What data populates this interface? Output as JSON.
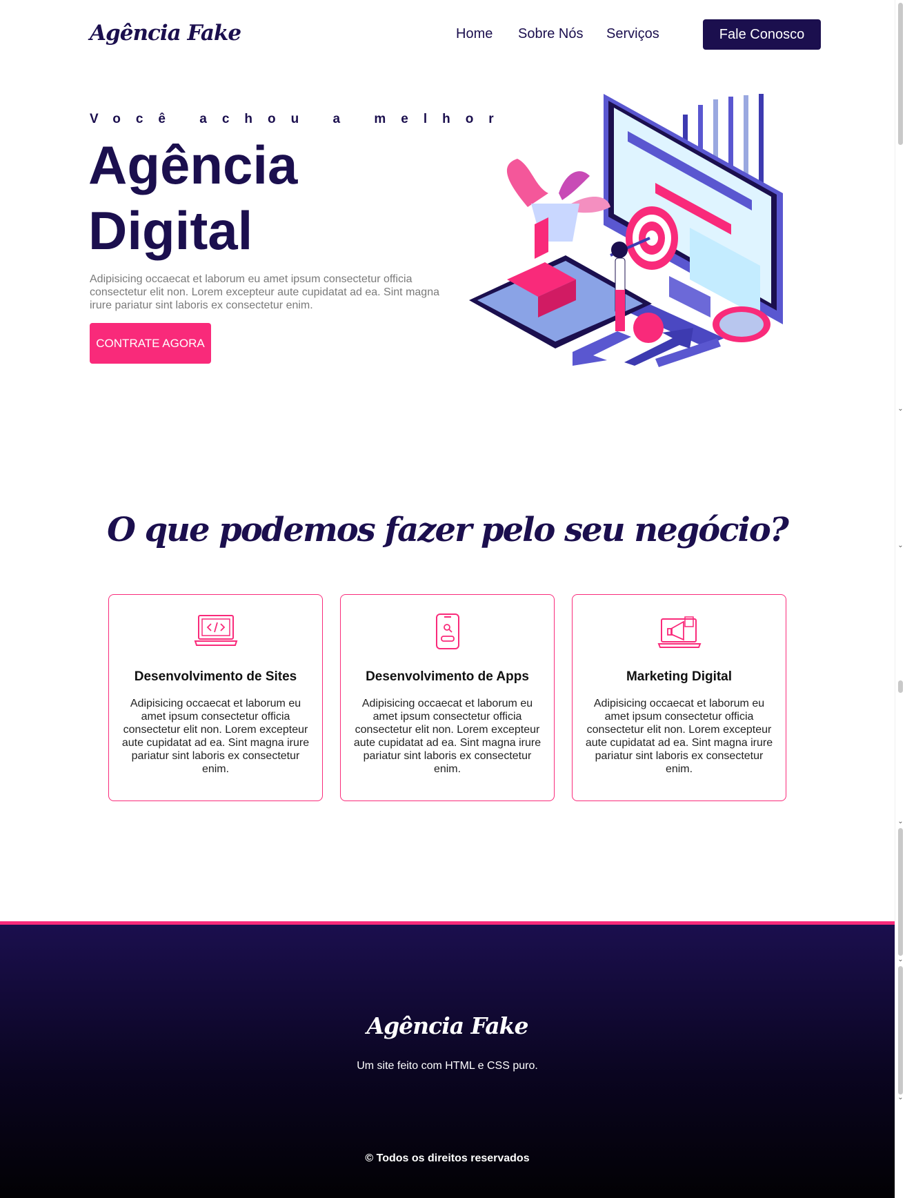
{
  "header": {
    "logo": "Agência Fake",
    "nav": {
      "home": "Home",
      "about": "Sobre Nós",
      "services": "Serviços"
    },
    "cta": "Fale Conosco"
  },
  "hero": {
    "subtitle": "Você achou a melhor",
    "title_line1": "Agência",
    "title_line2": "Digital",
    "text": "Adipisicing occaecat et laborum eu amet ipsum consectetur officia consectetur elit non. Lorem excepteur aute cupidatat ad ea. Sint magna irure pariatur sint laboris ex consectetur enim.",
    "button": "CONTRATE AGORA"
  },
  "services": {
    "title": "O que podemos fazer pelo seu negócio?",
    "cards": [
      {
        "icon": "laptop-code-icon",
        "title": "Desenvolvimento de Sites",
        "text": "Adipisicing occaecat et laborum eu amet ipsum consectetur officia consectetur elit non. Lorem excepteur aute cupidatat ad ea. Sint magna irure pariatur sint laboris ex consectetur enim."
      },
      {
        "icon": "mobile-app-icon",
        "title": "Desenvolvimento de Apps",
        "text": "Adipisicing occaecat et laborum eu amet ipsum consectetur officia consectetur elit non. Lorem excepteur aute cupidatat ad ea. Sint magna irure pariatur sint laboris ex consectetur enim."
      },
      {
        "icon": "megaphone-laptop-icon",
        "title": "Marketing Digital",
        "text": "Adipisicing occaecat et laborum eu amet ipsum consectetur officia consectetur elit non. Lorem excepteur aute cupidatat ad ea. Sint magna irure pariatur sint laboris ex consectetur enim."
      }
    ]
  },
  "footer": {
    "logo": "Agência Fake",
    "tagline": "Um site feito com HTML e CSS puro.",
    "copyright": "© Todos os direitos reservados"
  },
  "colors": {
    "primary": "#1b0f4e",
    "accent": "#f92a7a",
    "text_muted": "#7a7a7a"
  }
}
